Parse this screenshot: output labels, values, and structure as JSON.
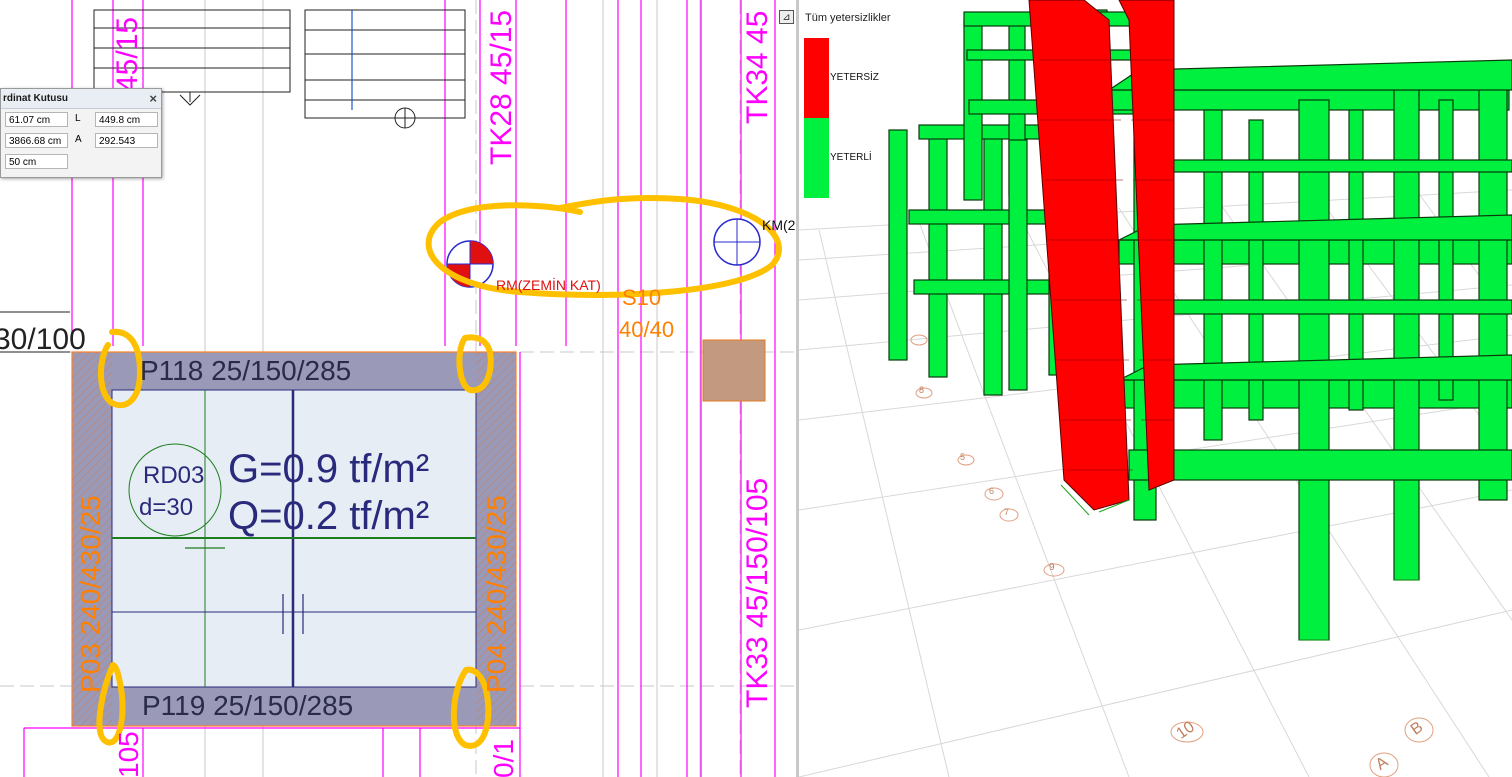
{
  "coord_box": {
    "title": "rdinat Kutusu",
    "close": "×",
    "row1_value": "61.07 cm",
    "row1_label": "L",
    "row1_value2": "449.8 cm",
    "row2_value": "3866.68 cm",
    "row2_label": "A",
    "row2_value2": "292.543",
    "row3_value": "50 cm"
  },
  "plan": {
    "beam_top_left": "45/15",
    "beam_tk28": "TK28 45/15",
    "beam_tk34": "TK34 45",
    "beam_tk33": "TK33 45/150/105",
    "beam_left_top": "30/100",
    "beam_p118": "P118 25/150/285",
    "beam_p119": "P119 25/150/285",
    "beam_p03": "P03 240/430/25",
    "beam_p04": "P04 240/430/25",
    "beam_bottom_left": "105",
    "beam_bottom_mid": "0/1",
    "column_s10_name": "S10",
    "column_s10_size": "40/40",
    "rm_label": "RM(ZEMİN KAT)",
    "km_label": "KM(2",
    "hole_name": "RD03",
    "hole_diameter": "d=30",
    "load_g": "G=0.9 tf/m²",
    "load_q": "Q=0.2 tf/m²",
    "colors": {
      "magenta": "#ff00ff",
      "orange": "#ff8000",
      "navy": "#2a2a7c",
      "highlight": "#ffc000",
      "slab_fill": "#e6edf5",
      "beam_fill": "#9a9ab8"
    }
  },
  "model_view": {
    "button": "⊿",
    "legend_title": "Tüm yetersizlikler",
    "legend_bad": "YETERSİZ",
    "legend_good": "YETERLİ",
    "color_bad": "#ff0000",
    "color_good": "#00f040",
    "axis_labels": [
      "5",
      "6",
      "7",
      "8",
      "9",
      "10",
      "B",
      "A"
    ]
  }
}
